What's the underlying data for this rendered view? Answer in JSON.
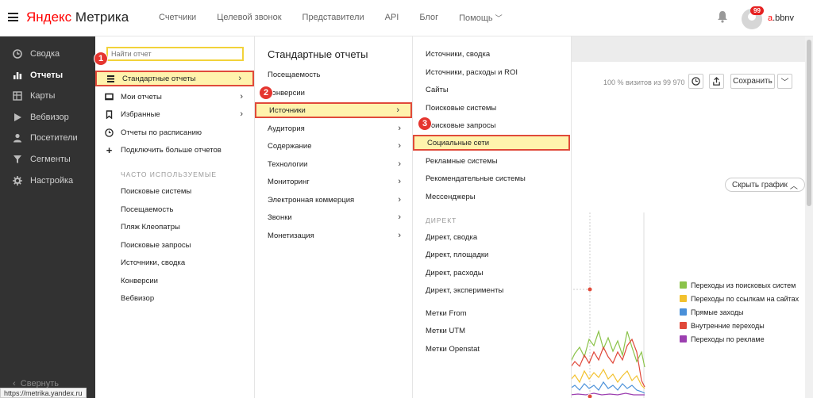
{
  "header": {
    "logo_brand": "Яндекс",
    "logo_product": "Метрика",
    "nav": [
      "Счетчики",
      "Целевой звонок",
      "Представители",
      "API",
      "Блог",
      "Помощь"
    ],
    "notifications_count": "99",
    "username_first": "a",
    "username_rest": ".bbnv"
  },
  "sidebar": {
    "items": [
      {
        "label": "Сводка",
        "icon": "clock-icon"
      },
      {
        "label": "Отчеты",
        "icon": "bar-chart-icon"
      },
      {
        "label": "Карты",
        "icon": "map-icon"
      },
      {
        "label": "Вебвизор",
        "icon": "play-icon"
      },
      {
        "label": "Посетители",
        "icon": "person-icon"
      },
      {
        "label": "Сегменты",
        "icon": "funnel-icon"
      },
      {
        "label": "Настройка",
        "icon": "gear-icon"
      }
    ],
    "collapse_label": "Свернуть"
  },
  "menu": {
    "search_placeholder": "Найти отчет",
    "col1": {
      "items": [
        "Стандартные отчеты",
        "Мои отчеты",
        "Избранные",
        "Отчеты по расписанию",
        "Подключить больше отчетов"
      ],
      "section": "ЧАСТО ИСПОЛЬЗУЕМЫЕ",
      "frequent": [
        "Поисковые системы",
        "Посещаемость",
        "Пляж Клеопатры",
        "Поисковые запросы",
        "Источники, сводка",
        "Конверсии",
        "Вебвизор"
      ]
    },
    "col2": {
      "title": "Стандартные отчеты",
      "items": [
        "Посещаемость",
        "Конверсии",
        "Источники",
        "Аудитория",
        "Содержание",
        "Технологии",
        "Мониторинг",
        "Электронная коммерция",
        "Звонки",
        "Монетизация"
      ]
    },
    "col3": {
      "items": [
        "Источники, сводка",
        "Источники, расходы и ROI",
        "Сайты",
        "Поисковые системы",
        "Поисковые запросы",
        "Социальные сети",
        "Рекламные системы",
        "Рекомендательные системы",
        "Мессенджеры"
      ],
      "section": "ДИРЕКТ",
      "direct": [
        "Директ, сводка",
        "Директ, площадки",
        "Директ, расходы",
        "Директ, эксперименты"
      ],
      "tags": [
        "Метки From",
        "Метки UTM",
        "Метки Openstat"
      ]
    },
    "steps": [
      "1",
      "2",
      "3"
    ]
  },
  "report": {
    "visits_stat": "100 % визитов из 99 970",
    "save_label": "Сохранить",
    "hide_graph_label": "Скрыть график",
    "legend": [
      {
        "label": "Переходы из поисковых систем",
        "color": "#8bc34a"
      },
      {
        "label": "Переходы по ссылкам на сайтах",
        "color": "#f2c12e"
      },
      {
        "label": "Прямые заходы",
        "color": "#4a90d9"
      },
      {
        "label": "Внутренние переходы",
        "color": "#e0483a"
      },
      {
        "label": "Переходы по рекламе",
        "color": "#9c3fb0"
      }
    ]
  },
  "statusbar": {
    "url": "https://metrika.yandex.ru"
  }
}
